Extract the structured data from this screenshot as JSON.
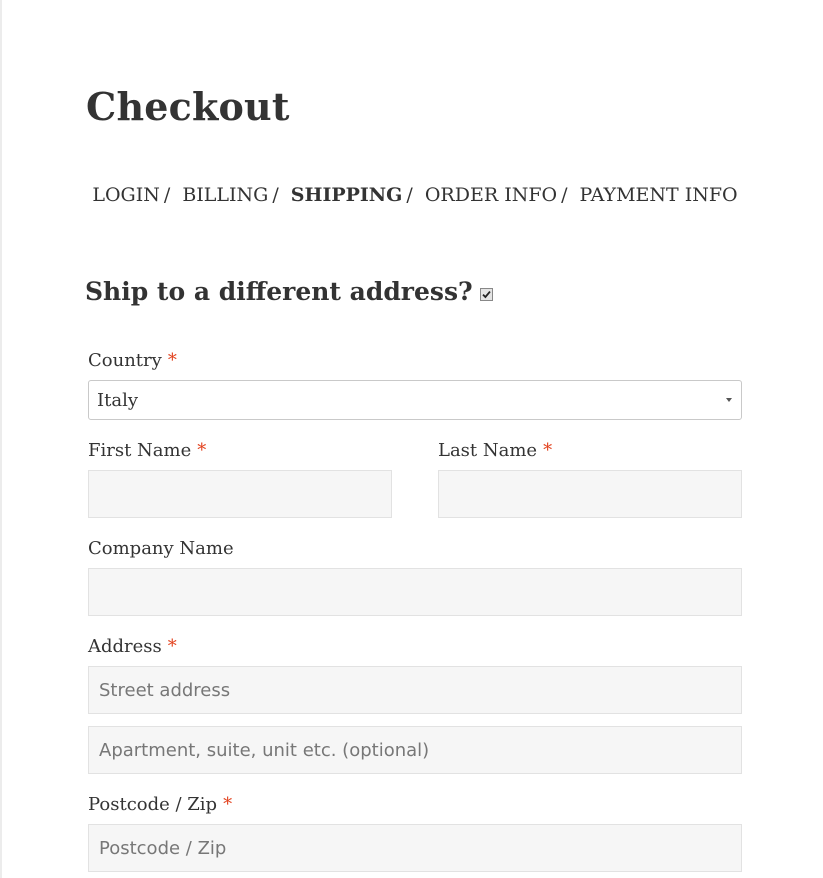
{
  "page": {
    "title": "Checkout"
  },
  "steps": [
    {
      "label": "LOGIN",
      "current": false
    },
    {
      "label": "BILLING",
      "current": false
    },
    {
      "label": "SHIPPING",
      "current": true
    },
    {
      "label": "ORDER INFO",
      "current": false
    },
    {
      "label": "PAYMENT INFO",
      "current": false
    }
  ],
  "step_separator": "/",
  "shipping": {
    "heading": "Ship to a different address?",
    "different_address_checked": true
  },
  "form": {
    "required_mark": "*",
    "country": {
      "label": "Country",
      "value": "Italy"
    },
    "first_name": {
      "label": "First Name",
      "value": ""
    },
    "last_name": {
      "label": "Last Name",
      "value": ""
    },
    "company": {
      "label": "Company Name",
      "value": ""
    },
    "address": {
      "label": "Address",
      "street_placeholder": "Street address",
      "apartment_placeholder": "Apartment, suite, unit etc. (optional)"
    },
    "postcode": {
      "label": "Postcode / Zip",
      "placeholder": "Postcode / Zip"
    }
  },
  "colors": {
    "required": "#e2401c",
    "input_background": "#f6f6f6",
    "input_border": "#e2e2e2",
    "text": "#333333"
  }
}
